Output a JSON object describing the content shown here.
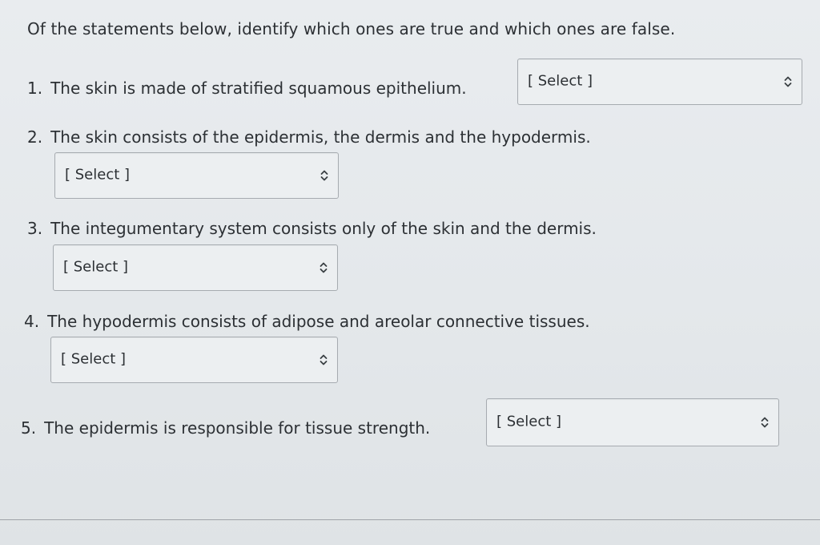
{
  "instruction": "Of the statements below, identify which ones are true and which ones are false.",
  "questions": [
    {
      "number": "1.",
      "text": "The skin is made of stratified squamous epithelium.",
      "select_value": "[ Select ]"
    },
    {
      "number": "2.",
      "text": "The skin consists of the epidermis, the dermis and the hypodermis.",
      "select_value": "[ Select ]"
    },
    {
      "number": "3.",
      "text": "The integumentary system consists only of the skin and the dermis.",
      "select_value": "[ Select ]"
    },
    {
      "number": "4.",
      "text": "The hypodermis consists of adipose and areolar connective tissues.",
      "select_value": "[ Select ]"
    },
    {
      "number": "5.",
      "text": "The epidermis is responsible for tissue strength.",
      "select_value": "[ Select ]"
    }
  ],
  "icons": {
    "select_arrow": "up-down-chevron-icon"
  }
}
